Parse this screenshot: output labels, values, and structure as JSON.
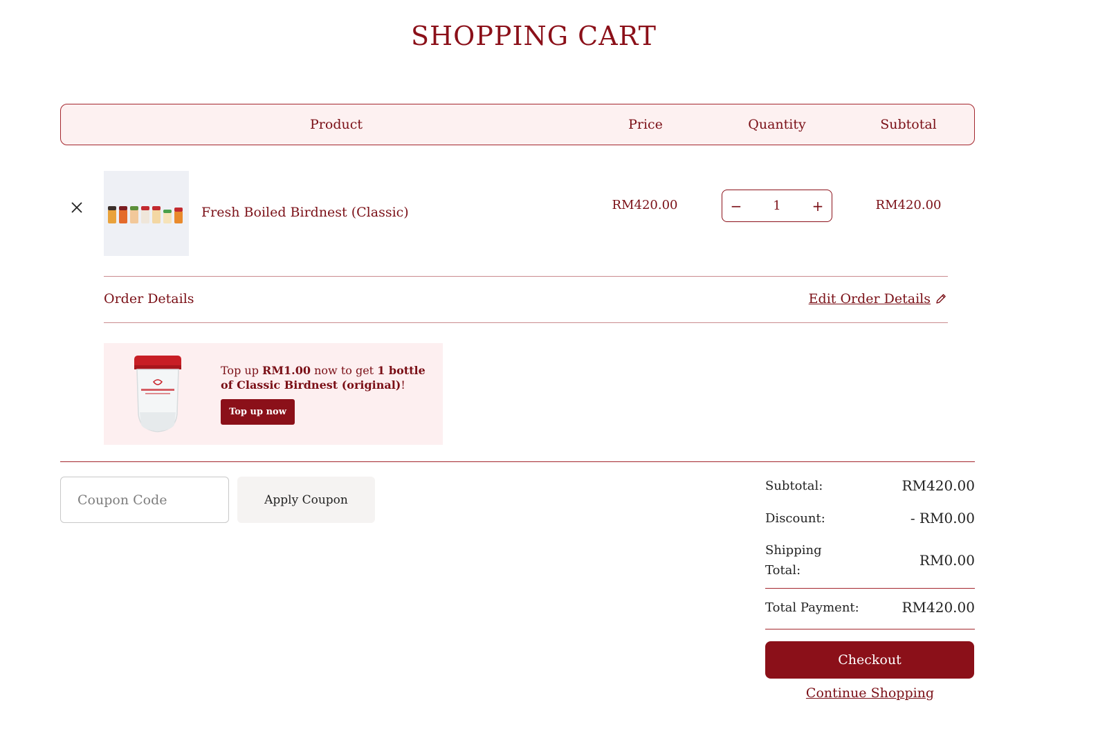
{
  "page": {
    "title": "SHOPPING CART"
  },
  "table_header": {
    "product": "Product",
    "price": "Price",
    "quantity": "Quantity",
    "subtotal": "Subtotal"
  },
  "cart_item": {
    "name": "Fresh Boiled Birdnest (Classic)",
    "price": "RM420.00",
    "quantity": "1",
    "subtotal": "RM420.00",
    "decrement_symbol": "−",
    "increment_symbol": "+"
  },
  "order_details": {
    "label": "Order Details",
    "edit_link": "Edit Order Details"
  },
  "promo": {
    "text_prefix": "Top up ",
    "amount": "RM1.00",
    "text_middle": " now to get ",
    "reward": "1 bottle of Classic Birdnest (original)",
    "text_suffix": "!",
    "button_label": "Top up now"
  },
  "coupon": {
    "placeholder": "Coupon Code",
    "value": "",
    "button_label": "Apply Coupon"
  },
  "summary": {
    "subtotal_label": "Subtotal:",
    "subtotal_value": "RM420.00",
    "discount_label": "Discount:",
    "discount_value": "- RM0.00",
    "shipping_label": "Shipping Total:",
    "shipping_value": "RM0.00",
    "total_label": "Total Payment:",
    "total_value": "RM420.00"
  },
  "actions": {
    "checkout": "Checkout",
    "continue_shopping": "Continue Shopping"
  },
  "colors": {
    "accent": "#8b1019",
    "header_bg": "#fdf1f1",
    "promo_bg": "#fdeff0",
    "button_secondary_bg": "#f5f3f2"
  }
}
